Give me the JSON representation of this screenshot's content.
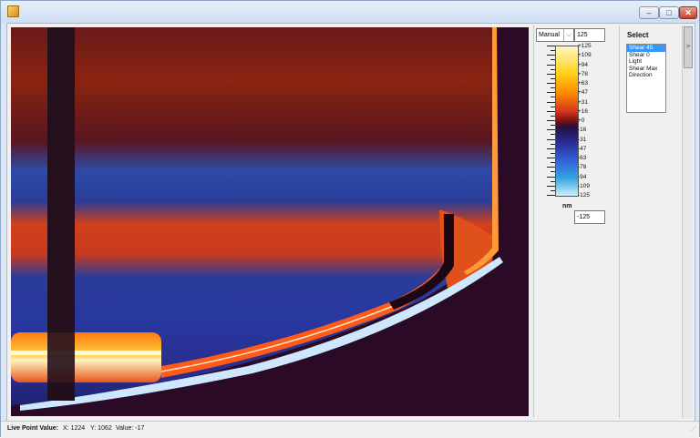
{
  "window": {
    "title": ""
  },
  "title_buttons": {
    "minimize": "–",
    "maximize": "□",
    "close": "✕"
  },
  "mode_select": {
    "value": "Manual",
    "arrow": "⌵"
  },
  "scale": {
    "max_value": "125",
    "min_value": "-125",
    "unit": "nm",
    "labels": [
      "+125",
      "+109",
      "+94",
      "+78",
      "+63",
      "+47",
      "+31",
      "+16",
      "+0",
      "-16",
      "-31",
      "-47",
      "-63",
      "-78",
      "-94",
      "-109",
      "-125"
    ],
    "colors": {
      "high": "#fff8c0",
      "mid_pos": "#d9381e",
      "zero": "#241040",
      "mid_neg": "#3260d8",
      "low": "#cfefff"
    }
  },
  "select_panel": {
    "title": "Select",
    "items": [
      "Shear 45",
      "Shear 0",
      "Light",
      "Shear Max",
      "Direction"
    ],
    "selected_index": 0
  },
  "scroll": {
    "thumb_glyph": ">"
  },
  "status": {
    "label": "Live Point Value:",
    "x": "X: 1224",
    "y": "Y: 1062",
    "value": "Value: -17"
  }
}
